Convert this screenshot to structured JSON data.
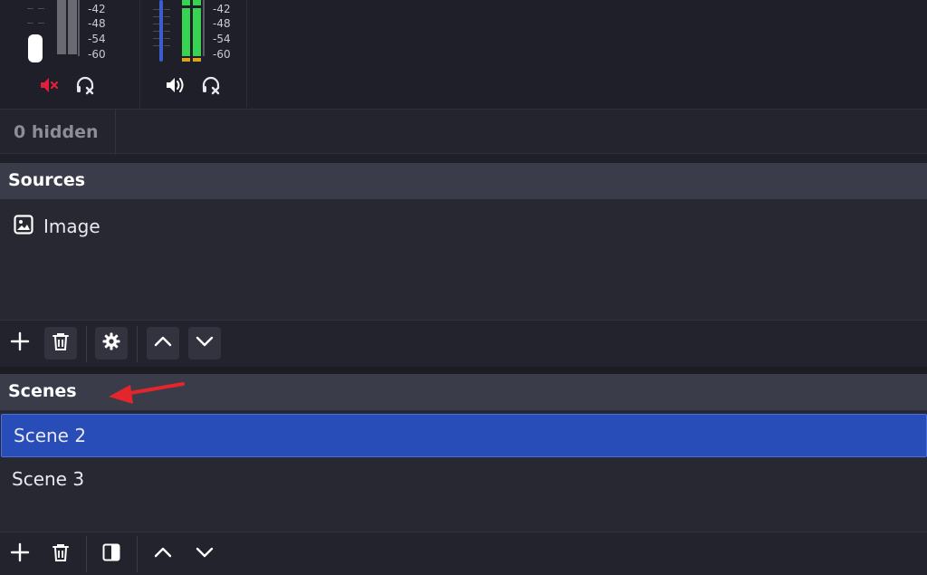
{
  "mixer": {
    "channels": [
      {
        "name": "channel-1",
        "db_labels": [
          "-42",
          "-48",
          "-54",
          "-60"
        ],
        "mute_icon": "speaker-muted-icon",
        "monitor_icon": "headphones-off-icon",
        "muted": true
      },
      {
        "name": "channel-2",
        "db_labels": [
          "-42",
          "-48",
          "-54",
          "-60"
        ],
        "mute_icon": "speaker-volume-icon",
        "monitor_icon": "headphones-off-icon",
        "muted": false
      }
    ],
    "colors": {
      "fader_blue": "#3a5ccc",
      "meter_green": "#39d353",
      "meter_yellow": "#e0a21a",
      "mute_red": "#e0203a"
    }
  },
  "hidden_bar": {
    "label": "0 hidden"
  },
  "sources": {
    "title": "Sources",
    "items": [
      {
        "label": "Image",
        "icon": "image-icon"
      }
    ],
    "toolbar": [
      "add-icon",
      "trash-icon",
      "gear-icon",
      "chevron-up-icon",
      "chevron-down-icon"
    ]
  },
  "scenes": {
    "title": "Scenes",
    "items": [
      {
        "label": "Scene 2",
        "selected": true
      },
      {
        "label": "Scene 3",
        "selected": false
      }
    ],
    "toolbar": [
      "add-icon",
      "trash-icon",
      "filter-icon",
      "chevron-up-icon",
      "chevron-down-icon"
    ],
    "selection_color": "#284cb8"
  },
  "annotation": {
    "icon": "red-arrow-icon",
    "color": "#e3262b"
  }
}
